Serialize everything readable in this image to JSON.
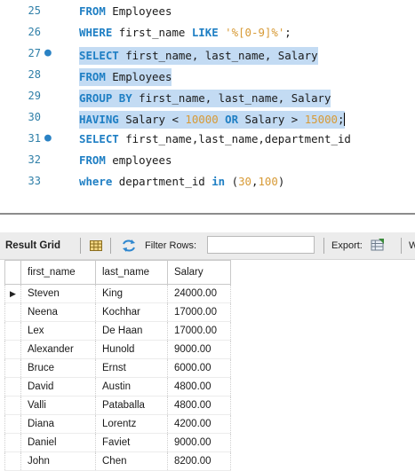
{
  "editor": {
    "lines": [
      {
        "n": "25",
        "dot": false,
        "sel": false,
        "parts": [
          [
            "kw",
            "FROM"
          ],
          [
            "t",
            " Employees"
          ]
        ]
      },
      {
        "n": "26",
        "dot": false,
        "sel": false,
        "parts": [
          [
            "kw",
            "WHERE"
          ],
          [
            "t",
            " first_name "
          ],
          [
            "kw",
            "LIKE"
          ],
          [
            "t",
            " "
          ],
          [
            "str",
            "'%[0-9]%'"
          ],
          [
            "t",
            ";"
          ]
        ]
      },
      {
        "n": "27",
        "dot": true,
        "sel": true,
        "parts": [
          [
            "kw",
            "SELECT"
          ],
          [
            "t",
            " first_name, last_name, Salary"
          ]
        ]
      },
      {
        "n": "28",
        "dot": false,
        "sel": true,
        "parts": [
          [
            "kw",
            "FROM"
          ],
          [
            "t",
            " Employees"
          ]
        ]
      },
      {
        "n": "29",
        "dot": false,
        "sel": true,
        "parts": [
          [
            "kw",
            "GROUP BY"
          ],
          [
            "t",
            " first_name, last_name, Salary"
          ]
        ]
      },
      {
        "n": "30",
        "dot": false,
        "sel": true,
        "cursor": true,
        "parts": [
          [
            "kw",
            "HAVING"
          ],
          [
            "t",
            " Salary < "
          ],
          [
            "num",
            "10000"
          ],
          [
            "t",
            " "
          ],
          [
            "kw",
            "OR"
          ],
          [
            "t",
            " Salary > "
          ],
          [
            "num",
            "15000"
          ],
          [
            "t",
            ";"
          ]
        ]
      },
      {
        "n": "31",
        "dot": true,
        "sel": false,
        "parts": [
          [
            "kw",
            "SELECT"
          ],
          [
            "t",
            " first_name,last_name,department_id"
          ]
        ]
      },
      {
        "n": "32",
        "dot": false,
        "sel": false,
        "parts": [
          [
            "kw",
            "FROM"
          ],
          [
            "t",
            " employees"
          ]
        ]
      },
      {
        "n": "33",
        "dot": false,
        "sel": false,
        "parts": [
          [
            "kw",
            "where"
          ],
          [
            "t",
            " department_id "
          ],
          [
            "kw",
            "in"
          ],
          [
            "t",
            " ("
          ],
          [
            "num",
            "30"
          ],
          [
            "t",
            ","
          ],
          [
            "num",
            "100"
          ],
          [
            "t",
            ")"
          ]
        ]
      }
    ]
  },
  "toolbar": {
    "result_grid_label": "Result Grid",
    "filter_label": "Filter Rows:",
    "filter_value": "",
    "export_label": "Export:",
    "wrap_label": "W"
  },
  "grid": {
    "columns": [
      "first_name",
      "last_name",
      "Salary"
    ],
    "rows": [
      [
        "Steven",
        "King",
        "24000.00"
      ],
      [
        "Neena",
        "Kochhar",
        "17000.00"
      ],
      [
        "Lex",
        "De Haan",
        "17000.00"
      ],
      [
        "Alexander",
        "Hunold",
        "9000.00"
      ],
      [
        "Bruce",
        "Ernst",
        "6000.00"
      ],
      [
        "David",
        "Austin",
        "4800.00"
      ],
      [
        "Valli",
        "Pataballa",
        "4800.00"
      ],
      [
        "Diana",
        "Lorentz",
        "4200.00"
      ],
      [
        "Daniel",
        "Faviet",
        "9000.00"
      ],
      [
        "John",
        "Chen",
        "8200.00"
      ]
    ],
    "current_row_marker": "▶"
  },
  "colors": {
    "keyword": "#1f7fc4",
    "literal": "#d79a36",
    "selection": "#c3dbf3",
    "line_number": "#2f7fa8"
  }
}
